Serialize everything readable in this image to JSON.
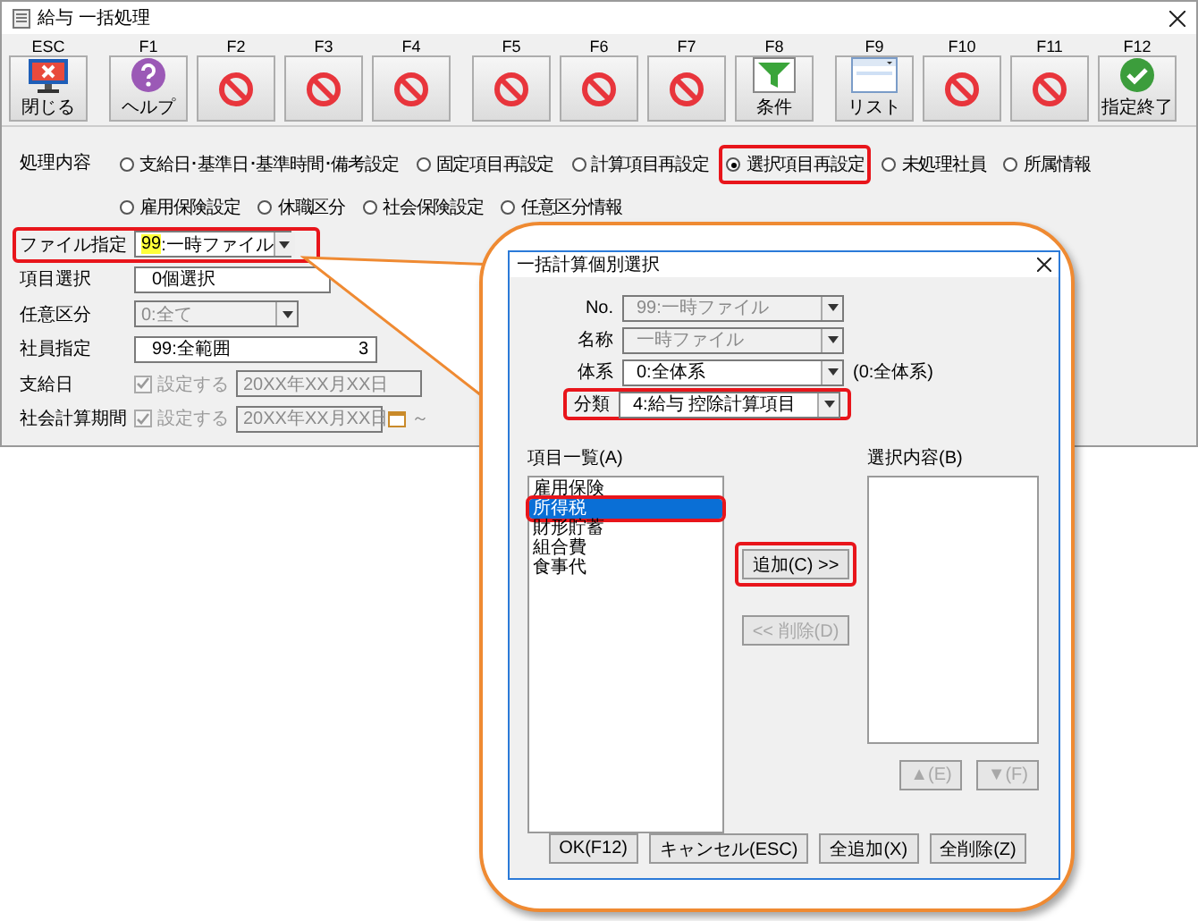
{
  "window": {
    "title": "給与 一括処理"
  },
  "toolbar_groups": [
    [
      {
        "key": "ESC",
        "label": "閉じる",
        "disabled": false
      }
    ],
    [
      {
        "key": "F1",
        "label": "ヘルプ",
        "disabled": false
      },
      {
        "key": "F2",
        "disabled": true
      },
      {
        "key": "F3",
        "disabled": true
      },
      {
        "key": "F4",
        "disabled": true
      }
    ],
    [
      {
        "key": "F5",
        "disabled": true
      },
      {
        "key": "F6",
        "disabled": true
      },
      {
        "key": "F7",
        "disabled": true
      },
      {
        "key": "F8",
        "label": "条件",
        "disabled": false
      }
    ],
    [
      {
        "key": "F9",
        "label": "リスト",
        "disabled": false
      },
      {
        "key": "F10",
        "disabled": true
      },
      {
        "key": "F11",
        "disabled": true
      },
      {
        "key": "F12",
        "label": "指定終了",
        "disabled": false
      }
    ]
  ],
  "processing": {
    "label": "処理内容",
    "options": [
      {
        "label": "支給日･基準日･基準時間･備考設定",
        "selected": false,
        "highlighted": false
      },
      {
        "label": "固定項目再設定",
        "selected": false,
        "highlighted": false
      },
      {
        "label": "計算項目再設定",
        "selected": false,
        "highlighted": false
      },
      {
        "label": "選択項目再設定",
        "selected": true,
        "highlighted": true
      },
      {
        "label": "未処理社員",
        "selected": false,
        "highlighted": false
      },
      {
        "label": "所属情報",
        "selected": false,
        "highlighted": false
      },
      {
        "label": "雇用保険設定",
        "selected": false,
        "highlighted": false
      },
      {
        "label": "休職区分",
        "selected": false,
        "highlighted": false
      },
      {
        "label": "社会保険設定",
        "selected": false,
        "highlighted": false
      },
      {
        "label": "任意区分情報",
        "selected": false,
        "highlighted": false
      }
    ]
  },
  "fields": [
    {
      "kind": "select",
      "label": "ファイル指定",
      "code": "99",
      "value": ":一時ファイル",
      "disabled": false,
      "highlighted": true
    },
    {
      "kind": "text",
      "label": "項目選択",
      "value": "0個選択",
      "disabled": false,
      "highlighted": false
    },
    {
      "kind": "select",
      "label": "任意区分",
      "value": "0:全て",
      "disabled": true,
      "highlighted": false
    },
    {
      "kind": "text",
      "label": "社員指定",
      "value": "99:全範囲",
      "extra": "3",
      "disabled": false,
      "highlighted": false
    },
    {
      "kind": "check-date",
      "label": "支給日",
      "check_label": "設定する",
      "checked": true,
      "value": "20XX年XX月XX日",
      "disabled": true,
      "highlighted": false
    },
    {
      "kind": "check-date",
      "label": "社会計算期間",
      "check_label": "設定する",
      "checked": true,
      "value": "20XX年XX月XX日",
      "extra": "～",
      "disabled": true,
      "highlighted": false
    }
  ],
  "dialog": {
    "title": "一括計算個別選択",
    "fields": [
      {
        "label": "No.",
        "value": "99:一時ファイル",
        "disabled": true,
        "highlighted": false
      },
      {
        "label": "名称",
        "value": "一時ファイル",
        "disabled": true,
        "highlighted": false
      },
      {
        "label": "体系",
        "value": "0:全体系",
        "note": "(0:全体系)",
        "disabled": false,
        "highlighted": false
      },
      {
        "label": "分類",
        "value": "4:給与 控除計算項目",
        "disabled": false,
        "highlighted": true
      }
    ],
    "list_a": {
      "label": "項目一覧(A)",
      "items": [
        {
          "text": "雇用保険",
          "selected": false,
          "highlighted": false
        },
        {
          "text": "所得税",
          "selected": true,
          "highlighted": true
        },
        {
          "text": "財形貯蓄",
          "selected": false,
          "highlighted": false
        },
        {
          "text": "組合費",
          "selected": false,
          "highlighted": false
        },
        {
          "text": "食事代",
          "selected": false,
          "highlighted": false
        }
      ]
    },
    "list_b": {
      "label": "選択内容(B)"
    },
    "add_button": {
      "label": "追加(C) >>",
      "disabled": false,
      "highlighted": true
    },
    "remove_button": {
      "label": "<< 削除(D)",
      "disabled": true,
      "highlighted": false
    },
    "move_buttons": [
      {
        "label": "▲(E)",
        "disabled": true
      },
      {
        "label": "▼(F)",
        "disabled": true
      }
    ],
    "footer_buttons": [
      "OK(F12)",
      "キャンセル(ESC)",
      "全追加(X)",
      "全削除(Z)"
    ]
  }
}
